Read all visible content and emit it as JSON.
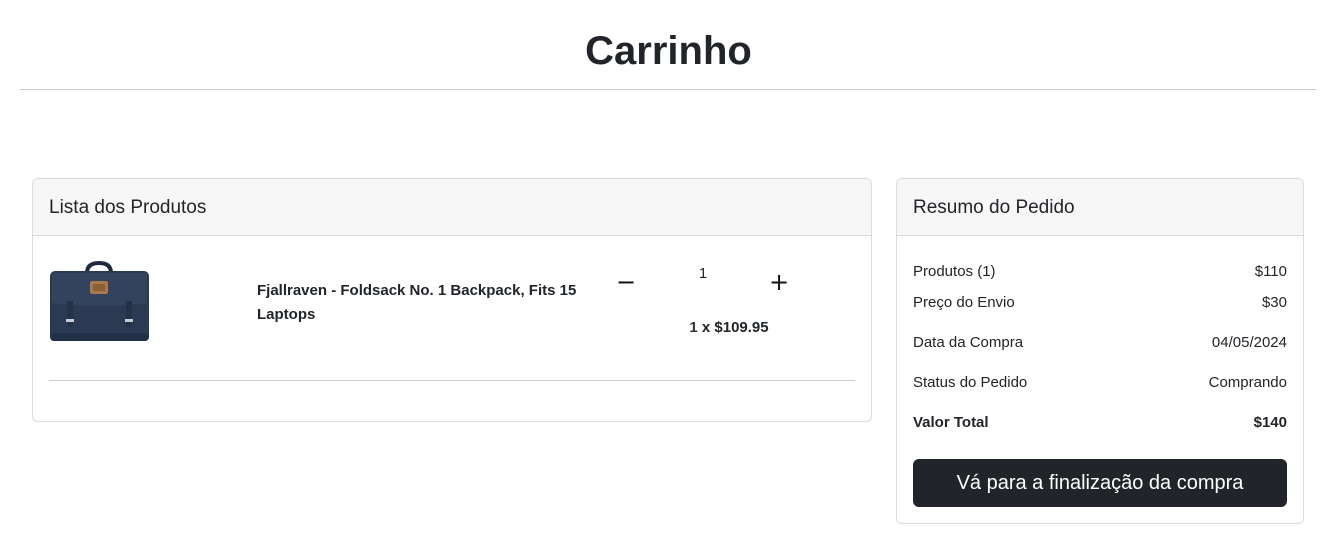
{
  "page": {
    "title": "Carrinho"
  },
  "products_card": {
    "header": "Lista dos Produtos",
    "items": [
      {
        "name": "Fjallraven - Foldsack No. 1 Backpack, Fits 15 Laptops",
        "quantity": "1",
        "decrement_label": "−",
        "increment_label": "+",
        "price_quantity": "1",
        "price_separator": " x ",
        "unit_price": "$109.95",
        "image_icon": "backpack-image"
      }
    ]
  },
  "summary_card": {
    "header": "Resumo do Pedido",
    "products_label": "Produtos (1)",
    "products_value": "$110",
    "shipping_label": "Preço do Envio",
    "shipping_value": "$30",
    "date_label": "Data da Compra",
    "date_value": "04/05/2024",
    "status_label": "Status do Pedido",
    "status_value": "Comprando",
    "total_label": "Valor Total",
    "total_value": "$140",
    "checkout_label": "Vá para a finalização da compra"
  },
  "colors": {
    "button_background": "#212529",
    "header_background": "#f7f7f7",
    "backpack_navy": "#2b3a52",
    "leather_tag": "#a8784a"
  }
}
